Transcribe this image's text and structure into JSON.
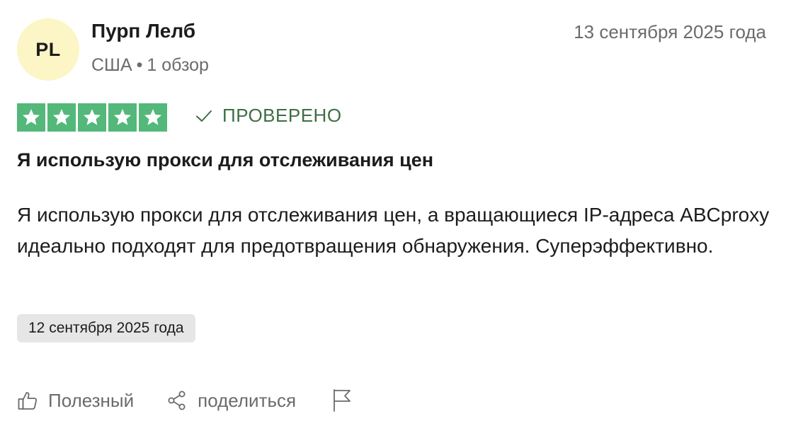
{
  "reviewer": {
    "initials": "PL",
    "name": "Пурп Лелб",
    "country": "США",
    "separator": "•",
    "review_count": "1 обзор"
  },
  "review": {
    "date": "13 сентября 2025 года",
    "rating": 5,
    "verified_label": "ПРОВЕРЕНО",
    "title": "Я использую прокси для отслеживания цен",
    "body": "Я использую прокси для отслеживания цен, а вращающиеся IP-адреса ABCproxy идеально подходят для предотвращения обнаружения. Суперэффективно.",
    "experience_date": "12 сентября 2025 года"
  },
  "actions": {
    "useful_label": "Полезный",
    "share_label": "поделиться",
    "report_icon": "flag-icon"
  },
  "colors": {
    "avatar_bg": "#fcf5c5",
    "star_bg": "#53b87a",
    "verified": "#3d6e44",
    "muted_text": "#6b6b6b",
    "chip_bg": "#e6e6e6"
  }
}
